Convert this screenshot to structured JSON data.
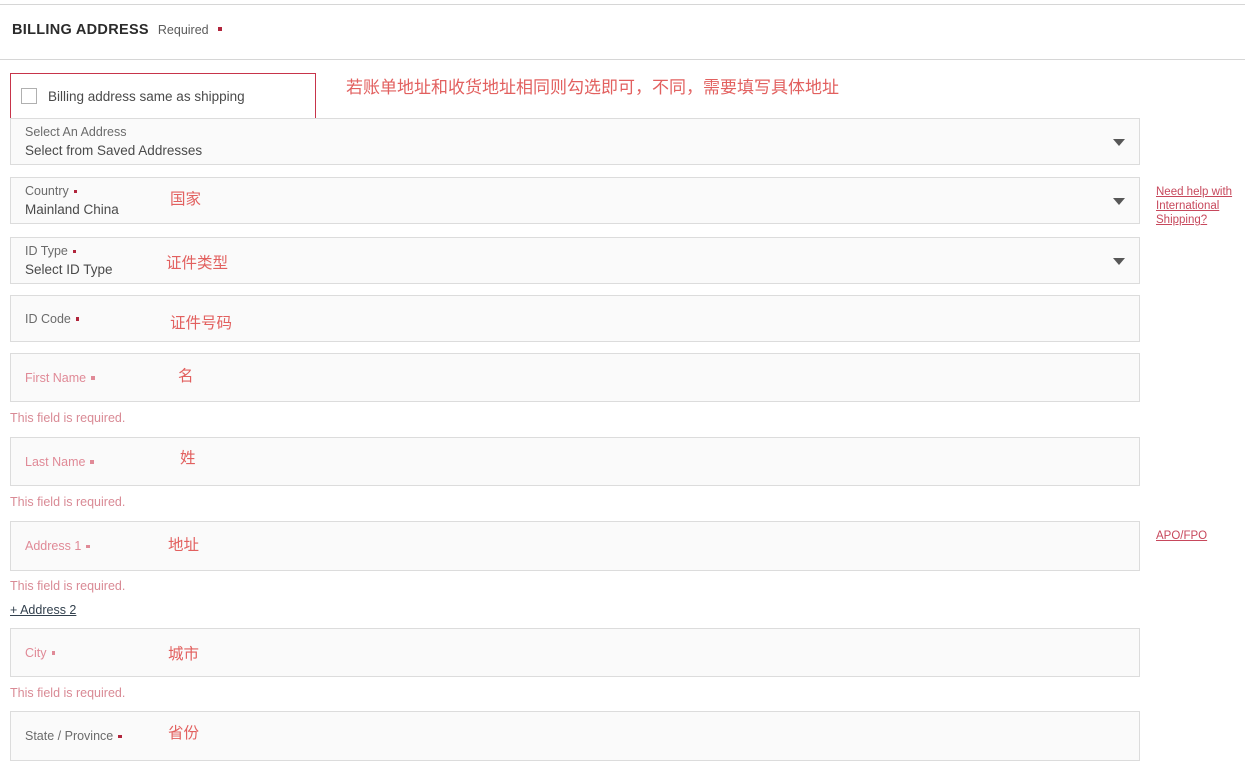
{
  "header": {
    "title": "BILLING ADDRESS",
    "required_label": "Required",
    "required_dot": "required-dot"
  },
  "checkbox": {
    "label": "Billing address same as shipping",
    "checked": false,
    "annotation": "若账单地址和收货地址相同则勾选即可，不同，需要填写具体地址"
  },
  "fields": [
    {
      "name": "select-an-address",
      "label": "Select An Address",
      "value": "Select from Saved Addresses",
      "required": false,
      "error_state": false,
      "has_caret": true,
      "annotation": "",
      "error_message": ""
    },
    {
      "name": "country",
      "label": "Country",
      "value": "Mainland China",
      "required": true,
      "error_state": false,
      "has_caret": true,
      "annotation": "国家",
      "error_message": ""
    },
    {
      "name": "id-type",
      "label": "ID Type",
      "value": "Select ID Type",
      "required": true,
      "error_state": false,
      "has_caret": true,
      "annotation": "证件类型",
      "error_message": ""
    },
    {
      "name": "id-code",
      "label": "ID Code",
      "value": "",
      "required": true,
      "error_state": false,
      "has_caret": false,
      "annotation": "证件号码",
      "error_message": ""
    },
    {
      "name": "first-name",
      "label": "First Name",
      "value": "",
      "required": true,
      "error_state": true,
      "has_caret": false,
      "annotation": "名",
      "error_message": "This field is required."
    },
    {
      "name": "last-name",
      "label": "Last Name",
      "value": "",
      "required": true,
      "error_state": true,
      "has_caret": false,
      "annotation": "姓",
      "error_message": "This field is required."
    },
    {
      "name": "address-1",
      "label": "Address 1",
      "value": "",
      "required": true,
      "error_state": true,
      "has_caret": false,
      "annotation": "地址",
      "error_message": "This field is required."
    },
    {
      "name": "city",
      "label": "City",
      "value": "",
      "required": true,
      "error_state": true,
      "has_caret": false,
      "annotation": "城市",
      "error_message": "This field is required."
    },
    {
      "name": "state-province",
      "label": "State / Province",
      "value": "",
      "required": true,
      "error_state": false,
      "has_caret": false,
      "annotation": "省份",
      "error_message": ""
    }
  ],
  "links": {
    "add_address_2": "+ Address 2",
    "need_help_shipping": "Need help with International Shipping?",
    "apo_fpo": "APO/FPO"
  },
  "colors": {
    "accent_red": "#b1253c",
    "annotation_red": "#e2605f",
    "error_pink": "#d98a95",
    "link_dark": "#33414e",
    "field_border": "#dcdcdc",
    "field_bg": "#fafafa"
  }
}
